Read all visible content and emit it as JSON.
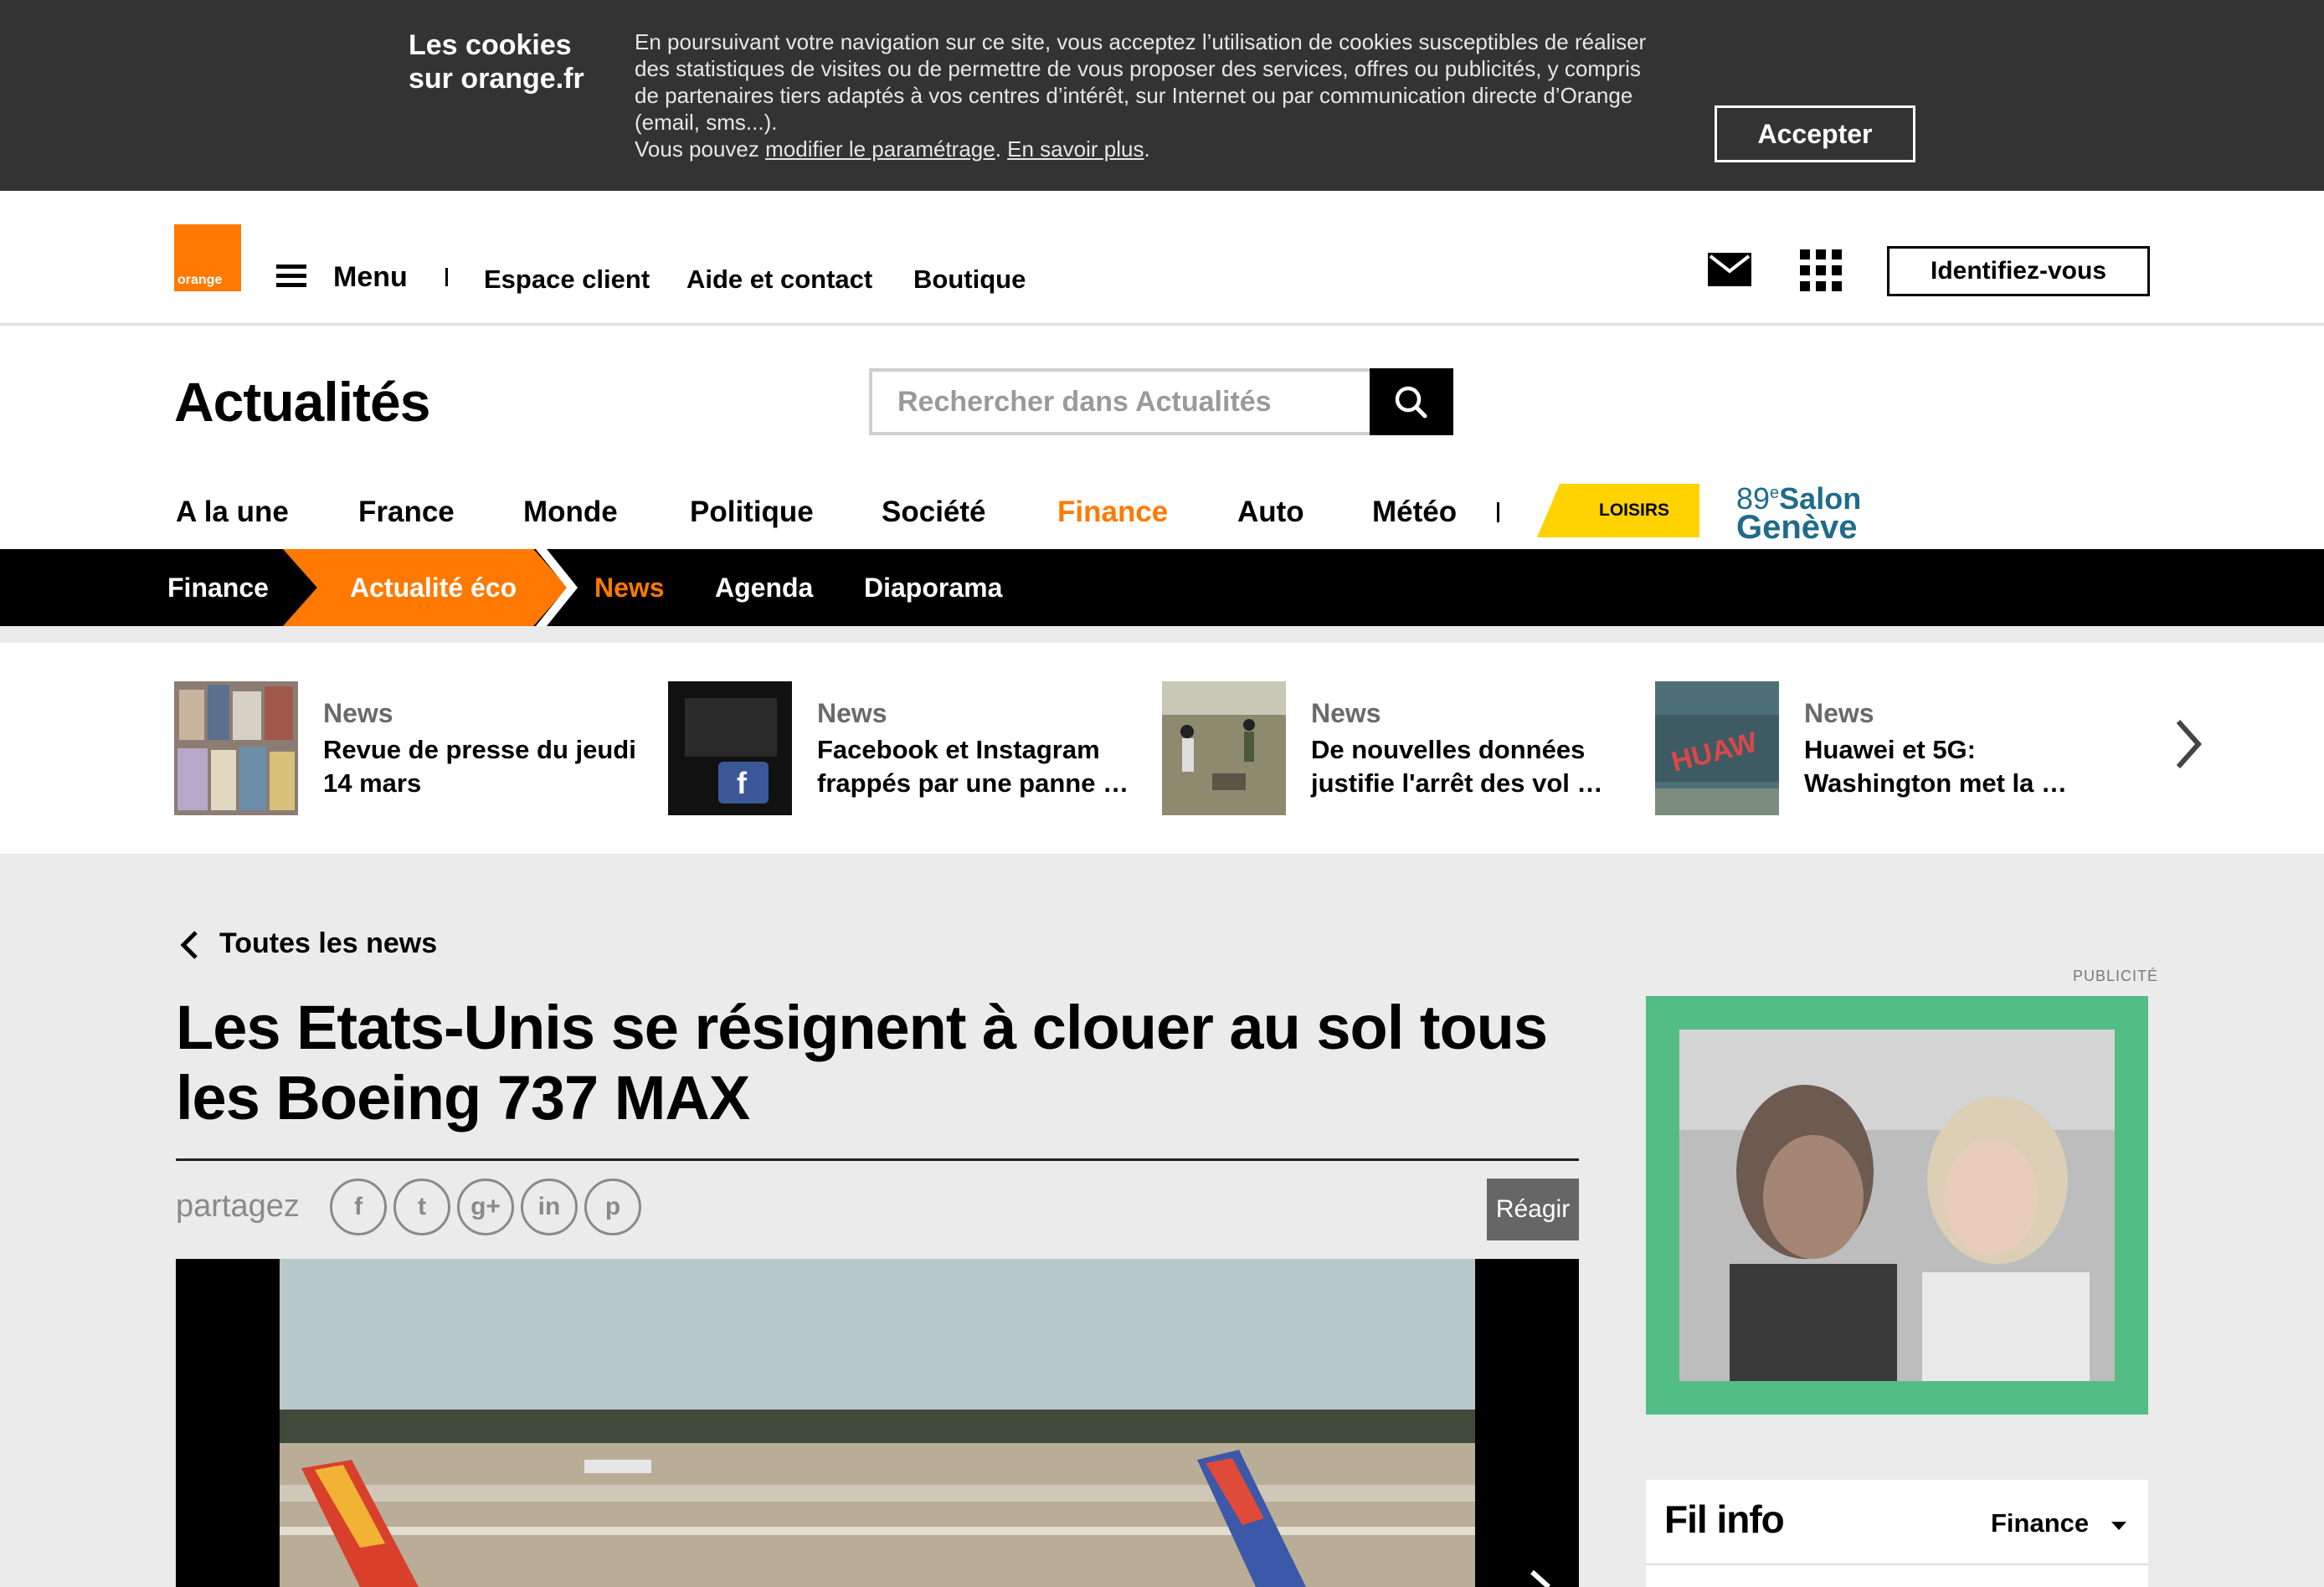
{
  "cookie": {
    "title": "Les cookies sur orange.fr",
    "text": "En poursuivant votre navigation sur ce site, vous acceptez l’utilisation de cookies susceptibles de réaliser des statistiques de visites ou de permettre de vous proposer des services, offres ou publicités, y compris de partenaires tiers adaptés à vos centres d’intérêt, sur Internet ou par communication directe d’Orange (email, sms...).",
    "text2_prefix": "Vous pouvez ",
    "link_settings": "modifier le paramétrage",
    "link_sep": ". ",
    "link_more": "En savoir plus",
    "text2_suffix": ".",
    "accept_label": "Accepter"
  },
  "header": {
    "logo_text": "orange",
    "menu_label": "Menu",
    "links": [
      "Espace client",
      "Aide et contact",
      "Boutique"
    ],
    "login_label": "Identifiez-vous",
    "icons": [
      "mail-icon",
      "apps-grid-icon",
      "hamburger-icon"
    ]
  },
  "section": {
    "title": "Actualités",
    "search_placeholder": "Rechercher dans Actualités",
    "nav": [
      "A la une",
      "France",
      "Monde",
      "Politique",
      "Société",
      "Finance",
      "Auto",
      "Météo"
    ],
    "active_nav": "Finance",
    "loisirs": "LOISIRS",
    "salon_num": "89",
    "salon_sup": "e",
    "salon_word": "Salon",
    "salon_city": "Genève"
  },
  "subnav": {
    "crumb1": "Finance",
    "crumb2": "Actualité éco",
    "links": [
      "News",
      "Agenda",
      "Diaporama"
    ],
    "active": "News"
  },
  "carousel": [
    {
      "type": "News",
      "title": "Revue de presse du jeudi 14 mars"
    },
    {
      "type": "News",
      "title": "Facebook et Instagram frappés par une panne …"
    },
    {
      "type": "News",
      "title": "De nouvelles données justifie l'arrêt des vol …"
    },
    {
      "type": "News",
      "title": "Huawei et 5G: Washington met la …"
    }
  ],
  "article": {
    "back_label": "Toutes les news",
    "title": "Les Etats-Unis se résignent à clouer au sol tous les Boeing 737 MAX",
    "share_label": "partagez",
    "social": [
      "f",
      "t",
      "g+",
      "in",
      "p"
    ],
    "react_label": "Réagir"
  },
  "sidebar": {
    "pub_label": "PUBLICITÉ",
    "fil_title": "Fil info",
    "fil_select": "Finance"
  },
  "colors": {
    "orange": "#ff7900",
    "cookie_bg": "#333333",
    "loisirs_yellow": "#ffd200",
    "ad_green": "#52bd84",
    "salon_blue": "#1f6b8a"
  }
}
